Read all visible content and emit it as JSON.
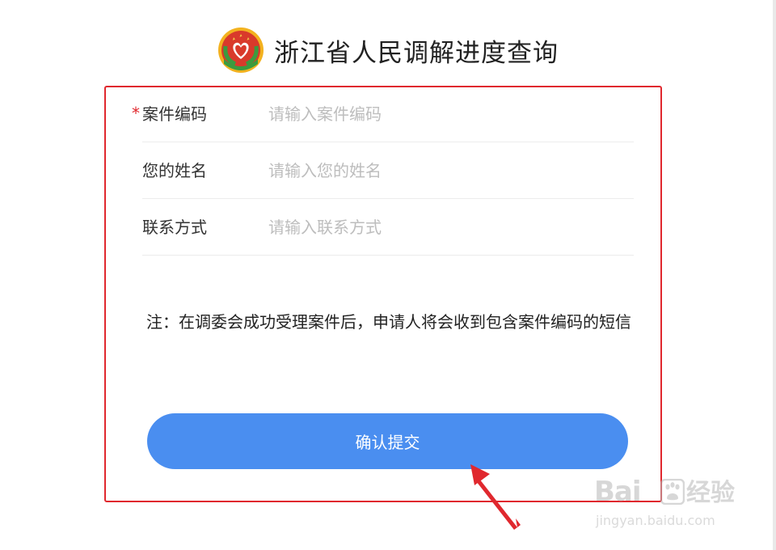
{
  "header": {
    "title": "浙江省人民调解进度查询"
  },
  "form": {
    "fields": [
      {
        "label": "案件编码",
        "placeholder": "请输入案件编码",
        "required_mark": "*"
      },
      {
        "label": "您的姓名",
        "placeholder": "请输入您的姓名"
      },
      {
        "label": "联系方式",
        "placeholder": "请输入联系方式"
      }
    ],
    "note": "注：在调委会成功受理案件后，申请人将会收到包含案件编码的短信",
    "submit_label": "确认提交"
  },
  "watermark": {
    "brand": "Bai",
    "brand_suffix": "经验",
    "url": "jingyan.baidu.com"
  },
  "colors": {
    "accent_button": "#4a8ef0",
    "annotation_red": "#e0282e",
    "placeholder": "#bdbdbd"
  },
  "icons": {
    "logo": "people-mediation-emblem-icon",
    "annotation": "red-arrow-icon",
    "watermark": "baidu-paw-icon"
  }
}
